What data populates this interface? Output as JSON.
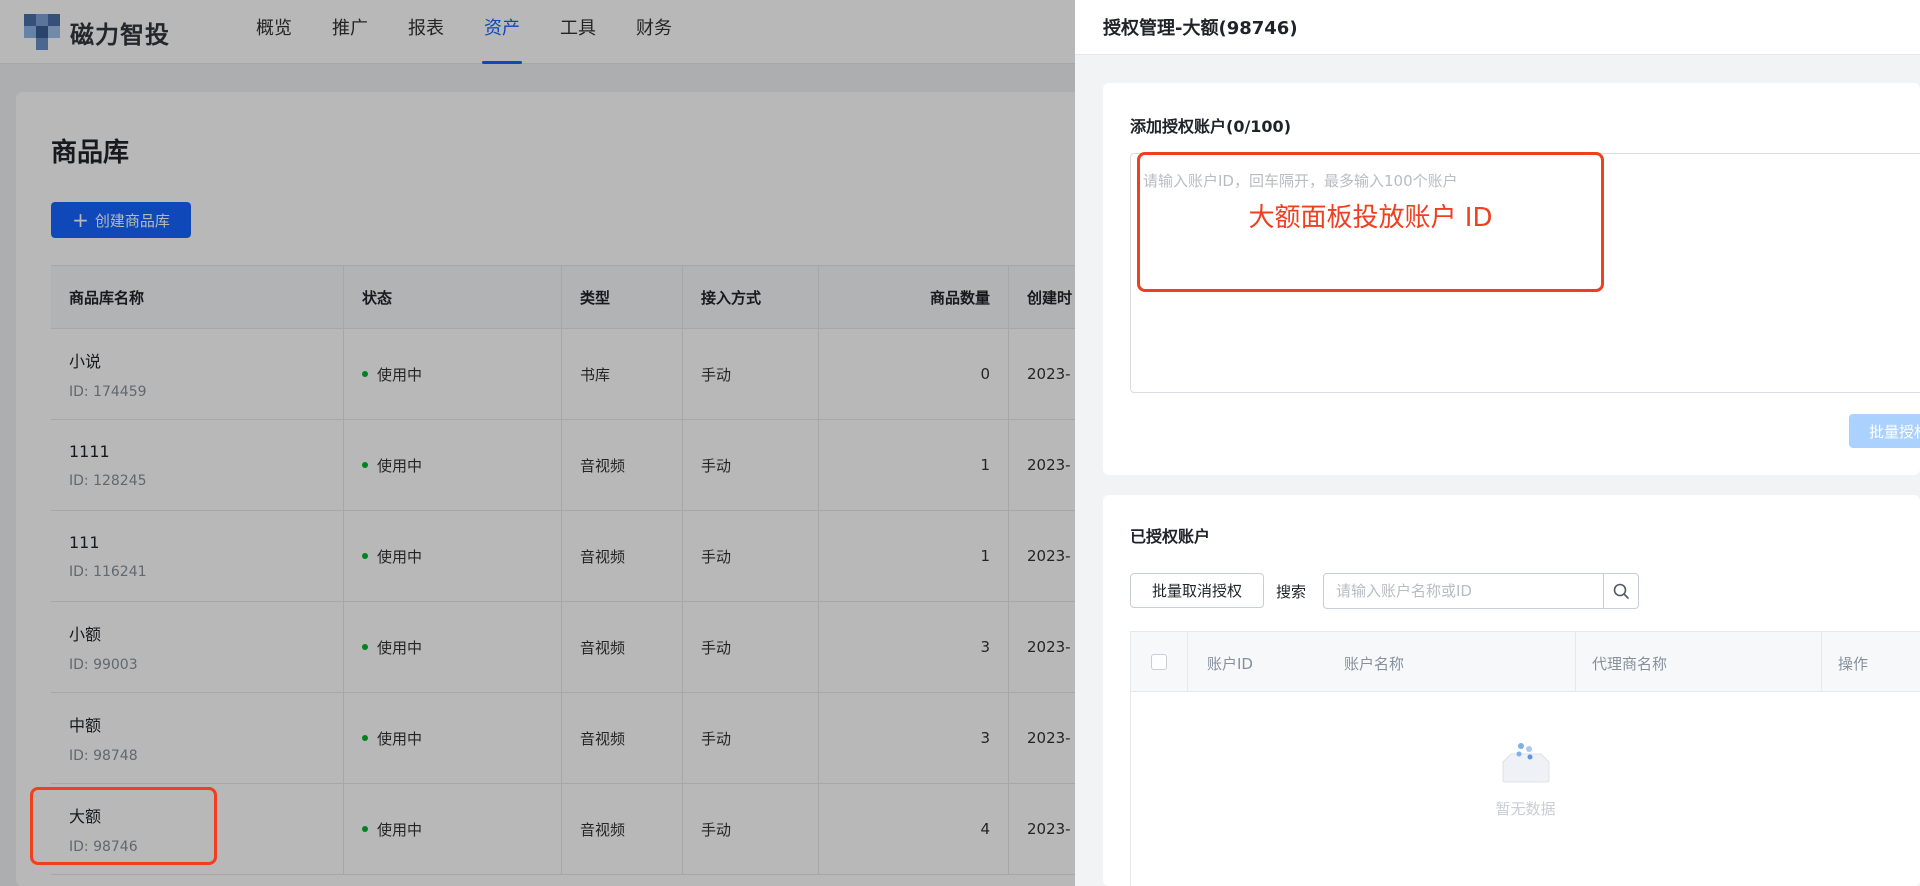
{
  "app": {
    "brand": "磁力智投",
    "nav": [
      "概览",
      "推广",
      "报表",
      "资产",
      "工具",
      "财务"
    ],
    "active_nav": "资产"
  },
  "page": {
    "title": "商品库",
    "create_button": "创建商品库",
    "columns": [
      "商品库名称",
      "状态",
      "类型",
      "接入方式",
      "商品数量",
      "创建时"
    ],
    "rows": [
      {
        "name": "小说",
        "id": "ID: 174459",
        "status": "使用中",
        "type": "书库",
        "access": "手动",
        "count": "0",
        "created": "2023-"
      },
      {
        "name": "1111",
        "id": "ID: 128245",
        "status": "使用中",
        "type": "音视频",
        "access": "手动",
        "count": "1",
        "created": "2023-"
      },
      {
        "name": "111",
        "id": "ID: 116241",
        "status": "使用中",
        "type": "音视频",
        "access": "手动",
        "count": "1",
        "created": "2023-"
      },
      {
        "name": "小额",
        "id": "ID: 99003",
        "status": "使用中",
        "type": "音视频",
        "access": "手动",
        "count": "3",
        "created": "2023-"
      },
      {
        "name": "中额",
        "id": "ID: 98748",
        "status": "使用中",
        "type": "音视频",
        "access": "手动",
        "count": "3",
        "created": "2023-"
      },
      {
        "name": "大额",
        "id": "ID: 98746",
        "status": "使用中",
        "type": "音视频",
        "access": "手动",
        "count": "4",
        "created": "2023-"
      }
    ]
  },
  "drawer": {
    "title": "授权管理-大额(98746)",
    "add_section_title": "添加授权账户(0/100)",
    "textarea_placeholder": "请输入账户ID，回车隔开，最多输入100个账户",
    "annotation": "大额面板投放账户 ID",
    "batch_authorize": "批量授权",
    "authorized_title": "已授权账户",
    "batch_revoke": "批量取消授权",
    "search_label": "搜索",
    "search_placeholder": "请输入账户名称或ID",
    "table_columns": [
      "账户ID",
      "账户名称",
      "代理商名称",
      "操作"
    ],
    "empty_text": "暂无数据"
  },
  "colors": {
    "primary": "#1664ff",
    "annotation": "#f03e1e",
    "status_active": "#00b42a"
  }
}
